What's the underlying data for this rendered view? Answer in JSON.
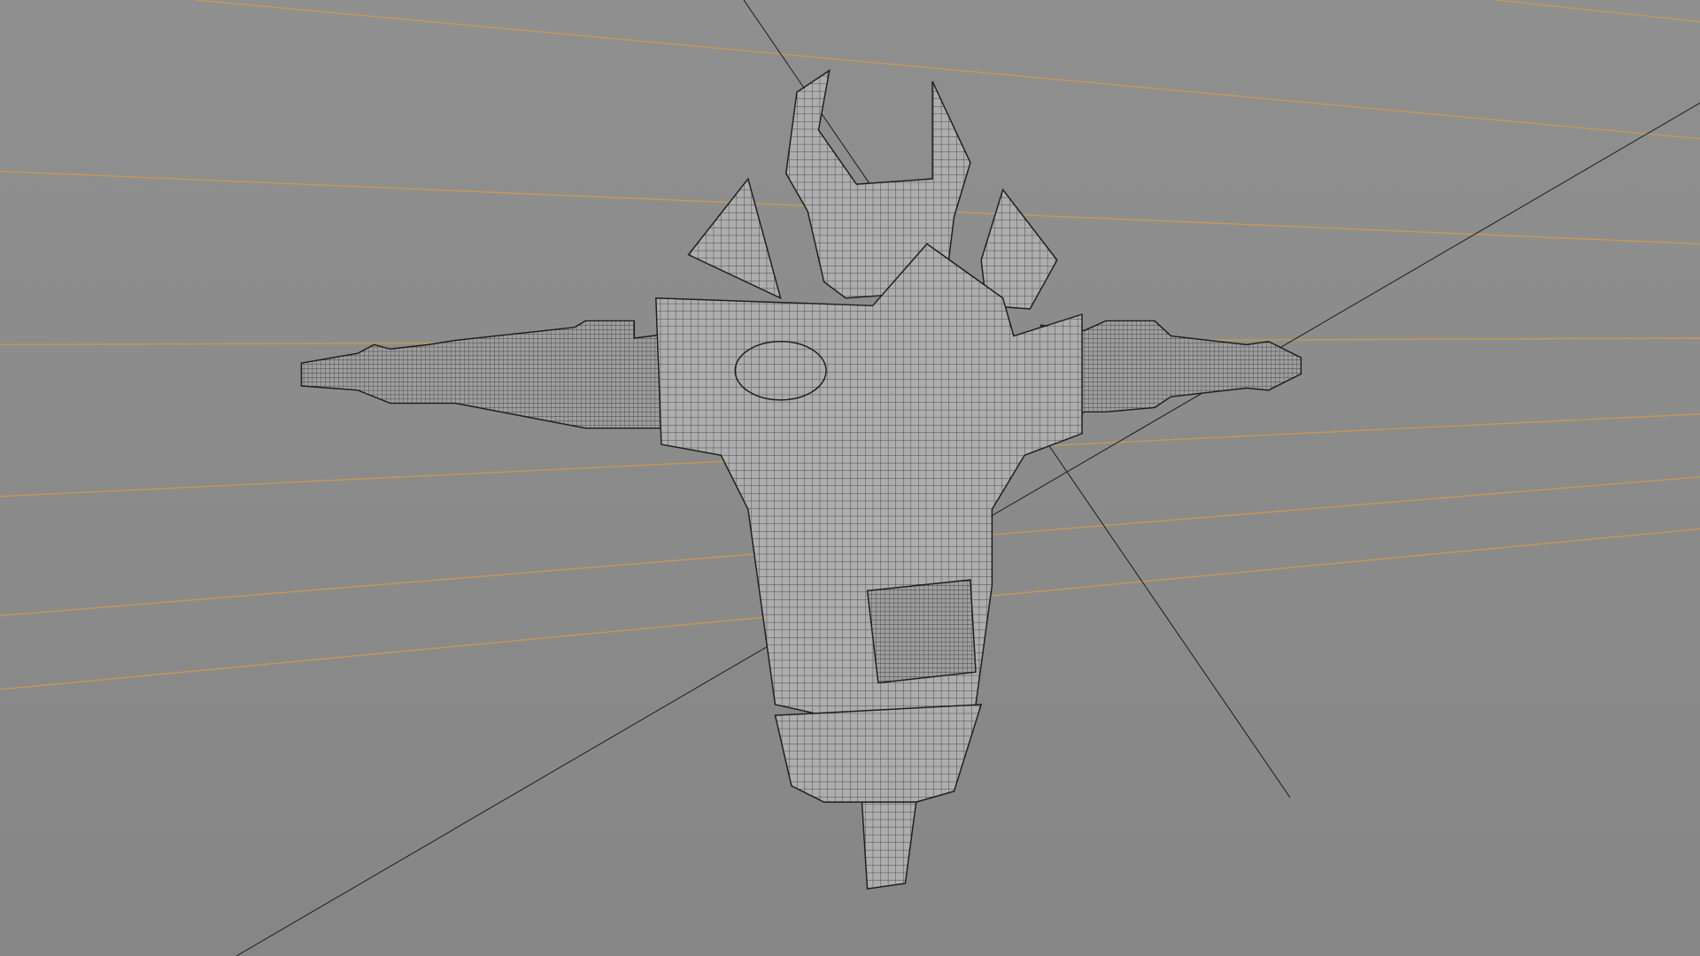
{
  "colors": {
    "background_top": "#8e8e8e",
    "background_bottom": "#858585",
    "guide_line": "#d49a4a",
    "axis_line": "#1a1a1a",
    "mesh_fill": "#a9a9a9",
    "mesh_wire": "#2a2a2a"
  }
}
